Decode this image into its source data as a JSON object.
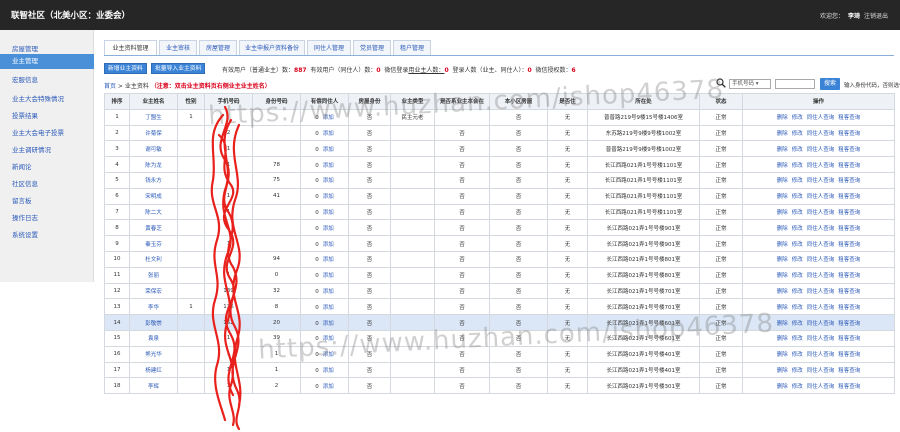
{
  "header": {
    "title": "联智社区（北美小区：业委会）",
    "welcome": "欢迎您：",
    "user": "李琦",
    "logout": "注销退出"
  },
  "sidebar": {
    "items": [
      {
        "label": "房屋管理"
      },
      {
        "label": "业主管理"
      },
      {
        "label": "宏服信息"
      },
      {
        "label": "业主大会特殊情况"
      },
      {
        "label": "投票结果"
      },
      {
        "label": "业主大会电子投票"
      },
      {
        "label": "业主调研情况"
      },
      {
        "label": "新闻论"
      },
      {
        "label": "社区信息"
      },
      {
        "label": "留言板"
      },
      {
        "label": "操作日志"
      },
      {
        "label": "系统设置"
      }
    ]
  },
  "tabs": [
    {
      "label": "业主资料管理"
    },
    {
      "label": "业主审核"
    },
    {
      "label": "房屋管理"
    },
    {
      "label": "业主申报户资料备份"
    },
    {
      "label": "同住人管理"
    },
    {
      "label": "党员管理"
    },
    {
      "label": "租户管理"
    }
  ],
  "toolbar": {
    "new_owner": "新增业主资料",
    "batch_import": "批量导入业主资料",
    "stat_label1": "有效用户（普通业主）数：",
    "stat_value1": "887",
    "stat_label2": "有效用户（同住人）数：",
    "stat_value2": "0",
    "stat_label3": "微信登录",
    "stat_label3b": "用业主人数：",
    "stat_value3": "0",
    "stat_label4": "登录人数（业主、同住人）：",
    "stat_value4": "0",
    "stat_label5": "微信授权数：",
    "stat_value5": "6"
  },
  "breadcrumb": {
    "home": "首页",
    "section": "业主资料",
    "warning": "（注意：双击业主资料页右侧业主业主姓名）"
  },
  "search": {
    "select_value": "手机号码",
    "button": "搜索",
    "hint": "输入身份代码，否则选代码"
  },
  "table": {
    "headers": [
      "排序",
      "业主姓名",
      "性别",
      "手机号码",
      "身份号码",
      "有偿同住人",
      "房屋身份",
      "业主类型",
      "是否系业主本会在",
      "本小区房屋",
      "是否住",
      "所在处",
      "状态",
      "操作"
    ],
    "rows": [
      {
        "no": "1",
        "name": "丁盟生",
        "gender": "1",
        "phone": "",
        "id": "",
        "cohab": "0",
        "cohab_link": "添加",
        "house": "否",
        "type": "民主元老",
        "rep": "",
        "local": "否",
        "live": "无",
        "addr": "普普路219号9楼15号楼1406室",
        "status": "正常"
      },
      {
        "no": "2",
        "name": "许菊保",
        "gender": "",
        "phone": "2",
        "id": "",
        "cohab": "0",
        "cohab_link": "添加",
        "house": "否",
        "type": "",
        "rep": "否",
        "local": "否",
        "live": "无",
        "addr": "东苏路219号9楼9号楼1002室",
        "status": "正常"
      },
      {
        "no": "3",
        "name": "谢可敏",
        "gender": "",
        "phone": "1",
        "id": "",
        "cohab": "0",
        "cohab_link": "添加",
        "house": "否",
        "type": "",
        "rep": "否",
        "local": "否",
        "live": "无",
        "addr": "普普路219号9楼9号楼1002室",
        "status": "正常"
      },
      {
        "no": "4",
        "name": "陈为龙",
        "gender": "",
        "phone": "1",
        "id": "78",
        "cohab": "0",
        "cohab_link": "添加",
        "house": "否",
        "type": "",
        "rep": "否",
        "local": "否",
        "live": "无",
        "addr": "长江西路021弄1号号楼1101室",
        "status": "正常"
      },
      {
        "no": "5",
        "name": "钱永方",
        "gender": "",
        "phone": "1",
        "id": "75",
        "cohab": "0",
        "cohab_link": "添加",
        "house": "否",
        "type": "",
        "rep": "否",
        "local": "否",
        "live": "无",
        "addr": "长江西路021弄1号号楼1101室",
        "status": "正常"
      },
      {
        "no": "6",
        "name": "宋明成",
        "gender": "",
        "phone": "1",
        "id": "41",
        "cohab": "0",
        "cohab_link": "添加",
        "house": "否",
        "type": "",
        "rep": "否",
        "local": "否",
        "live": "无",
        "addr": "长江西路021弄1号号楼1101室",
        "status": "正常"
      },
      {
        "no": "7",
        "name": "陈二大",
        "gender": "",
        "phone": "1",
        "id": "",
        "cohab": "0",
        "cohab_link": "添加",
        "house": "否",
        "type": "",
        "rep": "否",
        "local": "否",
        "live": "无",
        "addr": "长江西路021弄1号号楼1101室",
        "status": "正常"
      },
      {
        "no": "8",
        "name": "黄春芝",
        "gender": "",
        "phone": "1",
        "id": "",
        "cohab": "0",
        "cohab_link": "添加",
        "house": "否",
        "type": "",
        "rep": "否",
        "local": "否",
        "live": "无",
        "addr": "长江西路021弄1号号楼901室",
        "status": "正常"
      },
      {
        "no": "9",
        "name": "秦玉芬",
        "gender": "",
        "phone": "1",
        "id": "",
        "cohab": "0",
        "cohab_link": "添加",
        "house": "否",
        "type": "",
        "rep": "否",
        "local": "否",
        "live": "无",
        "addr": "长江西路021弄1号号楼901室",
        "status": "正常"
      },
      {
        "no": "10",
        "name": "杜文利",
        "gender": "",
        "phone": "1",
        "id": "94",
        "cohab": "0",
        "cohab_link": "添加",
        "house": "否",
        "type": "",
        "rep": "否",
        "local": "否",
        "live": "无",
        "addr": "长江西路021弄1号号楼801室",
        "status": "正常"
      },
      {
        "no": "11",
        "name": "张丽",
        "gender": "",
        "phone": "1",
        "id": "0",
        "cohab": "0",
        "cohab_link": "添加",
        "house": "否",
        "type": "",
        "rep": "否",
        "local": "否",
        "live": "无",
        "addr": "长江西路021弄1号号楼801室",
        "status": "正常"
      },
      {
        "no": "12",
        "name": "荣保宏",
        "gender": "",
        "phone": "139",
        "id": "32",
        "cohab": "0",
        "cohab_link": "添加",
        "house": "否",
        "type": "",
        "rep": "否",
        "local": "否",
        "live": "无",
        "addr": "长江西路021弄1号号楼701室",
        "status": "正常"
      },
      {
        "no": "13",
        "name": "李华",
        "gender": "1",
        "phone": "136",
        "id": "8",
        "cohab": "0",
        "cohab_link": "添加",
        "house": "否",
        "type": "",
        "rep": "否",
        "local": "否",
        "live": "无",
        "addr": "长江西路021弄1号号楼701室",
        "status": "正常"
      },
      {
        "no": "14",
        "name": "彭敬崇",
        "gender": "",
        "phone": "152",
        "id": "20",
        "cohab": "0",
        "cohab_link": "添加",
        "house": "否",
        "type": "",
        "rep": "否",
        "local": "否",
        "live": "无",
        "addr": "长江西路021弄1号号楼601室",
        "status": "正常"
      },
      {
        "no": "15",
        "name": "袁泉",
        "gender": "",
        "phone": "1",
        "id": "39",
        "cohab": "0",
        "cohab_link": "添加",
        "house": "否",
        "type": "",
        "rep": "否",
        "local": "否",
        "live": "无",
        "addr": "长江西路021弄1号号楼601室",
        "status": "正常"
      },
      {
        "no": "16",
        "name": "熊光华",
        "gender": "",
        "phone": "1",
        "id": "1",
        "cohab": "0",
        "cohab_link": "添加",
        "house": "否",
        "type": "",
        "rep": "否",
        "local": "否",
        "live": "无",
        "addr": "长江西路021弄1号号楼401室",
        "status": "正常"
      },
      {
        "no": "17",
        "name": "杨建红",
        "gender": "",
        "phone": "1",
        "id": "1",
        "cohab": "0",
        "cohab_link": "添加",
        "house": "否",
        "type": "",
        "rep": "否",
        "local": "否",
        "live": "无",
        "addr": "长江西路021弄1号号楼401室",
        "status": "正常"
      },
      {
        "no": "18",
        "name": "李辉",
        "gender": "",
        "phone": "1",
        "id": "2",
        "cohab": "0",
        "cohab_link": "添加",
        "house": "否",
        "type": "",
        "rep": "否",
        "local": "否",
        "live": "无",
        "addr": "长江西路021弄1号号楼301室",
        "status": "正常"
      }
    ],
    "ops": [
      "删除",
      "修改",
      "同住人查询",
      "租客查询"
    ]
  },
  "watermark": "https://www.huzhan.com/ishop46378"
}
